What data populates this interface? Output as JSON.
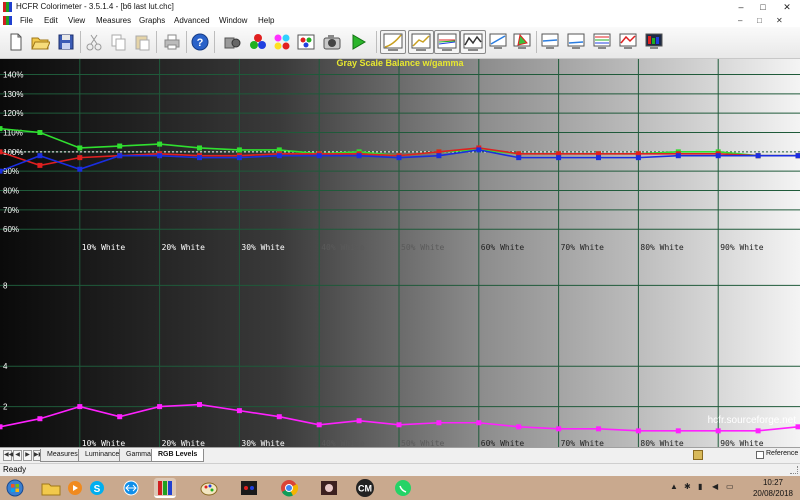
{
  "window": {
    "title": "HCFR Colorimeter - 3.5.1.4 - [b6 last lut.chc]",
    "minimize_glyph": "–",
    "maximize_glyph": "□",
    "close_glyph": "✕"
  },
  "menu": {
    "items": [
      "File",
      "Edit",
      "View",
      "Measures",
      "Graphs",
      "Advanced",
      "Window",
      "Help"
    ],
    "mdi_glyphs": [
      "–",
      "□",
      "✕"
    ]
  },
  "toolbar": {
    "buttons": [
      {
        "name": "new-document",
        "icon": "new-document-icon"
      },
      {
        "name": "open",
        "icon": "open-folder-icon"
      },
      {
        "name": "save",
        "icon": "save-icon"
      },
      {
        "name": "cut",
        "icon": "cut-icon"
      },
      {
        "name": "copy",
        "icon": "copy-icon"
      },
      {
        "name": "paste",
        "icon": "paste-icon"
      },
      {
        "name": "print",
        "icon": "print-icon"
      },
      {
        "name": "help",
        "icon": "help-icon"
      },
      {
        "name": "sensor",
        "icon": "sensor-icon"
      },
      {
        "name": "generator",
        "icon": "rgb-generator-icon"
      },
      {
        "name": "color-measures",
        "icon": "color-balls-icon"
      },
      {
        "name": "pattern",
        "icon": "pattern-icon"
      },
      {
        "name": "camera",
        "icon": "camera-icon"
      },
      {
        "name": "run",
        "icon": "play-icon"
      },
      {
        "name": "graph-luminance",
        "icon": "luminance-graph-icon"
      },
      {
        "name": "graph-gamma",
        "icon": "gamma-graph-icon"
      },
      {
        "name": "graph-rgb",
        "icon": "rgb-levels-graph-icon"
      },
      {
        "name": "graph-rgb-histogram",
        "icon": "rgb-histogram-icon"
      },
      {
        "name": "graph-saturation",
        "icon": "saturation-graph-icon"
      },
      {
        "name": "graph-cie",
        "icon": "cie-diagram-icon"
      },
      {
        "name": "graph-colortemp",
        "icon": "color-temp-graph-icon"
      },
      {
        "name": "graph-near-black",
        "icon": "near-black-graph-icon"
      },
      {
        "name": "graph-near-white",
        "icon": "near-white-graph-icon"
      },
      {
        "name": "graph-delta-e",
        "icon": "delta-e-graph-icon"
      },
      {
        "name": "graph-saturation-shift",
        "icon": "saturation-shift-icon"
      },
      {
        "name": "graph-color-checker",
        "icon": "color-checker-icon"
      }
    ]
  },
  "chart_data": {
    "type": "line",
    "title": "Gray Scale Balance w/gamma",
    "upper_ytick_labels": [
      "140%",
      "130%",
      "120%",
      "110%",
      "100%",
      "90%",
      "80%",
      "70%",
      "60%"
    ],
    "upper_yticks": [
      140,
      130,
      120,
      110,
      100,
      90,
      80,
      70,
      60
    ],
    "upper_ylim": [
      57,
      148
    ],
    "lower_ytick_labels": [
      "8",
      "4",
      "2"
    ],
    "lower_yticks": [
      8,
      4,
      2
    ],
    "lower_ylim": [
      0,
      10
    ],
    "x_labels": [
      "10% White",
      "20% White",
      "30% White",
      "40% White",
      "50% White",
      "60% White",
      "70% White",
      "80% White",
      "90% White"
    ],
    "x": [
      0,
      5,
      10,
      15,
      20,
      25,
      30,
      35,
      40,
      45,
      50,
      55,
      60,
      65,
      70,
      75,
      80,
      85,
      90,
      95,
      100
    ],
    "reference": 100,
    "series": [
      {
        "color": "#30e030",
        "values": [
          112,
          110,
          102,
          103,
          104,
          102,
          101,
          101,
          99,
          100,
          98,
          100,
          101,
          99,
          99,
          99,
          99,
          100,
          100,
          98,
          98
        ]
      },
      {
        "color": "#e02020",
        "values": [
          100,
          93,
          97,
          98,
          99,
          98,
          98,
          99,
          99,
          99,
          98,
          100,
          102,
          99,
          99,
          99,
          99,
          99,
          99,
          98,
          98
        ]
      },
      {
        "color": "#1a2ee0",
        "values": [
          90,
          98,
          91,
          98,
          98,
          97,
          97,
          98,
          98,
          98,
          97,
          98,
          101,
          97,
          97,
          97,
          97,
          98,
          98,
          98,
          98
        ]
      },
      {
        "color": "#ff20ff",
        "values": [
          1.0,
          1.4,
          2.0,
          1.5,
          2.0,
          2.1,
          1.8,
          1.5,
          1.1,
          1.3,
          1.1,
          1.2,
          1.2,
          1.0,
          0.9,
          0.9,
          0.8,
          0.8,
          0.8,
          0.8,
          1.0
        ]
      }
    ],
    "watermark": "hcfr.sourceforge.net"
  },
  "sheet_tabs": {
    "tabs": [
      "Measures",
      "Luminance",
      "Gamma",
      "RGB Levels"
    ],
    "active": 3,
    "nav": [
      "◀◀",
      "◀",
      "▶",
      "▶▶"
    ],
    "reference_label": "Reference"
  },
  "status": {
    "text": "Ready"
  },
  "taskbar": {
    "apps": [
      "start-icon",
      "explorer-icon",
      "media-player-icon",
      "skype-icon",
      "teamviewer-icon",
      "hcfr-icon",
      "paint-icon",
      "capture-icon",
      "chrome-icon",
      "photo-icon",
      "cm-icon",
      "whatsapp-icon"
    ],
    "cm_label": "CM",
    "time": "10:27",
    "date": "20/08/2018"
  },
  "colors": {
    "green": "#30e030",
    "red": "#e02020",
    "blue": "#1a2ee0",
    "magenta": "#ff20ff",
    "title": "#e8e830",
    "grid": "#1f5a3a"
  }
}
